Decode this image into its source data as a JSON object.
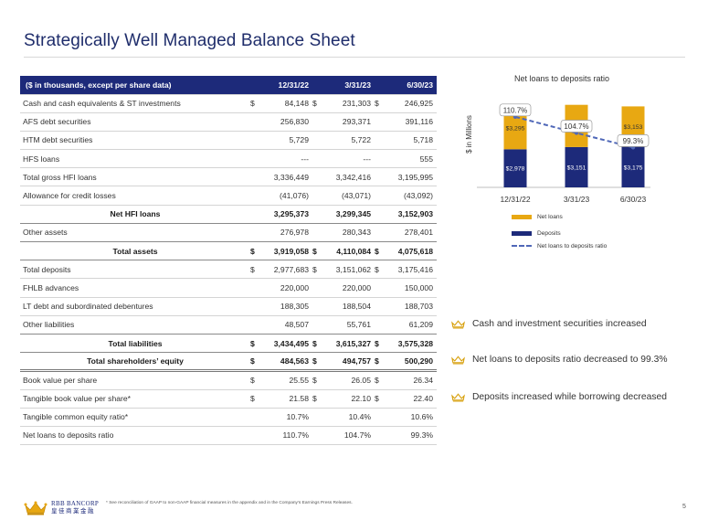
{
  "title": "Strategically Well Managed Balance Sheet",
  "table": {
    "header": {
      "label": "($ in thousands, except per share data)",
      "cols": [
        "12/31/22",
        "3/31/23",
        "6/30/23"
      ]
    },
    "rows": [
      {
        "label": "Cash and cash equivalents & ST investments",
        "dollar": "$",
        "v": [
          "84,148",
          "231,303",
          "246,925"
        ]
      },
      {
        "label": "AFS debt securities",
        "dollar": "",
        "v": [
          "256,830",
          "293,371",
          "391,116"
        ]
      },
      {
        "label": "HTM debt securities",
        "dollar": "",
        "v": [
          "5,729",
          "5,722",
          "5,718"
        ]
      },
      {
        "label": "HFS loans",
        "dollar": "",
        "v": [
          "---",
          "---",
          "555"
        ]
      },
      {
        "label": "Total gross HFI loans",
        "dollar": "",
        "v": [
          "3,336,449",
          "3,342,416",
          "3,195,995"
        ]
      },
      {
        "label": "Allowance for credit losses",
        "dollar": "",
        "v": [
          "(41,076)",
          "(43,071)",
          "(43,092)"
        ]
      },
      {
        "label": "Net HFI loans",
        "dollar": "",
        "v": [
          "3,295,373",
          "3,299,345",
          "3,152,903"
        ]
      },
      {
        "label": "Other assets",
        "dollar": "",
        "v": [
          "276,978",
          "280,343",
          "278,401"
        ]
      },
      {
        "label": "Total assets",
        "dollar": "$",
        "v": [
          "3,919,058",
          "4,110,084",
          "4,075,618"
        ]
      },
      {
        "label": "Total deposits",
        "dollar": "$",
        "v": [
          "2,977,683",
          "3,151,062",
          "3,175,416"
        ]
      },
      {
        "label": "FHLB advances",
        "dollar": "",
        "v": [
          "220,000",
          "220,000",
          "150,000"
        ]
      },
      {
        "label": "LT debt and subordinated debentures",
        "dollar": "",
        "v": [
          "188,305",
          "188,504",
          "188,703"
        ]
      },
      {
        "label": "Other liabilities",
        "dollar": "",
        "v": [
          "48,507",
          "55,761",
          "61,209"
        ]
      },
      {
        "label": "Total liabilities",
        "dollar": "$",
        "v": [
          "3,434,495",
          "3,615,327",
          "3,575,328"
        ]
      },
      {
        "label": "Total shareholders’ equity",
        "dollar": "$",
        "v": [
          "484,563",
          "494,757",
          "500,290"
        ]
      },
      {
        "label": "Book value per share",
        "dollar": "$",
        "v": [
          "25.55",
          "26.05",
          "26.34"
        ]
      },
      {
        "label": "Tangible book value per share*",
        "dollar": "$",
        "v": [
          "21.58",
          "22.10",
          "22.40"
        ]
      },
      {
        "label": "Tangible common equity ratio*",
        "dollar": "",
        "v": [
          "10.7%",
          "10.4%",
          "10.6%"
        ]
      },
      {
        "label": "Net loans to deposits ratio",
        "dollar": "",
        "v": [
          "110.7%",
          "104.7%",
          "99.3%"
        ]
      }
    ]
  },
  "chart_data": {
    "type": "bar",
    "title": "Net loans to deposits ratio",
    "ylabel": "$ in Millions",
    "categories": [
      "12/31/22",
      "3/31/23",
      "6/30/23"
    ],
    "series": [
      {
        "name": "Deposits",
        "values": [
          2978,
          3151,
          3175
        ],
        "labels": [
          "$2,978",
          "$3,151",
          "$3,175"
        ],
        "color": "#1d2a7a"
      },
      {
        "name": "Net loans",
        "values": [
          3295,
          3299,
          3153
        ],
        "labels": [
          "$3,295",
          "$3,299",
          "$3,153"
        ],
        "color": "#e8a812"
      }
    ],
    "line": {
      "name": "Net loans to deposits ratio",
      "values": [
        110.7,
        104.7,
        99.3
      ],
      "labels": [
        "110.7%",
        "104.7%",
        "99.3%"
      ],
      "color": "#5068b8"
    },
    "stacked": true
  },
  "bullets": [
    "Cash and investment securities increased",
    "Net loans to deposits ratio decreased to 99.3%",
    "Deposits increased while borrowing decreased"
  ],
  "footer": {
    "logo_line1": "RBB BANCORP",
    "logo_line2": "皇佳商業金融",
    "note": "* See reconciliation of GAAP to non-GAAP financial measures in the appendix and in the Company’s Earnings Press Releases.",
    "page": "5"
  },
  "colors": {
    "navy": "#1d2a7a",
    "gold": "#e8a812",
    "ratio_line": "#5068b8"
  }
}
